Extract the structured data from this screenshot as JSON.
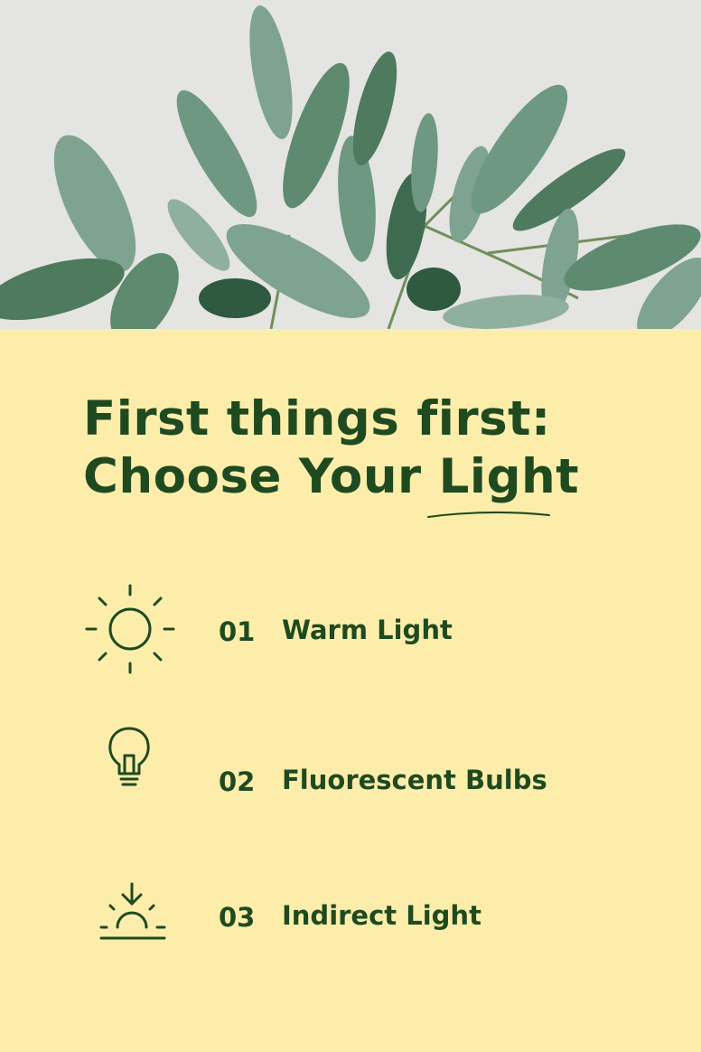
{
  "heading": {
    "line1": "First things first:",
    "line2_prefix": "Choose Your ",
    "line2_highlight": "Light"
  },
  "items": [
    {
      "number": "01",
      "label": "Warm Light",
      "icon": "sun-icon"
    },
    {
      "number": "02",
      "label": "Fluorescent Bulbs",
      "icon": "lightbulb-icon"
    },
    {
      "number": "03",
      "label": "Indirect Light",
      "icon": "sunset-icon"
    }
  ],
  "colors": {
    "background": "#FCEDAB",
    "text": "#1F4A1F",
    "leaf_dark": "#3E6B50",
    "leaf_light": "#7FA391"
  }
}
